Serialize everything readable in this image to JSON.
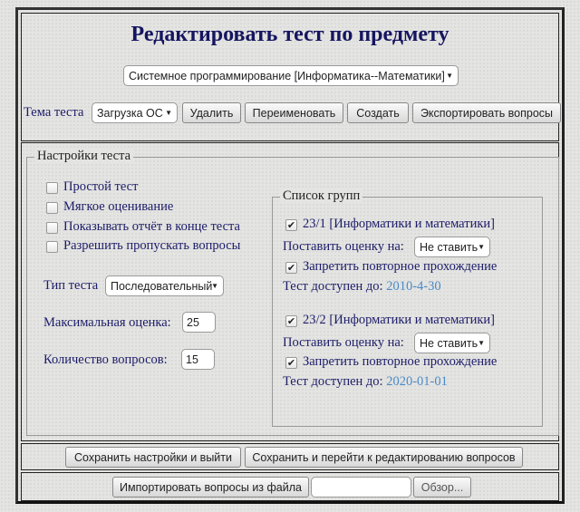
{
  "header": {
    "title": "Редактировать тест по предмету",
    "subject_select": "Системное программирование [Информатика--Математики]",
    "topic_label": "Тема теста",
    "topic_select": "Загрузка ОС",
    "delete": "Удалить",
    "rename": "Переименовать",
    "create": "Создать",
    "export": "Экспортировать вопросы"
  },
  "settings": {
    "legend": "Настройки теста",
    "options": [
      {
        "label": "Простой тест",
        "checked": false
      },
      {
        "label": "Мягкое оценивание",
        "checked": false
      },
      {
        "label": "Показывать отчёт в конце теста",
        "checked": false
      },
      {
        "label": "Разрешить пропускать вопросы",
        "checked": false
      }
    ],
    "type_label": "Тип теста",
    "type_value": "Последовательный",
    "max_label": "Максимальная оценка:",
    "max_value": "25",
    "count_label": "Количество вопросов:",
    "count_value": "15"
  },
  "groups": {
    "legend": "Список групп",
    "items": [
      {
        "name": "23/1 [Информатики и математики]",
        "checked": true,
        "grade_label": "Поставить оценку на:",
        "grade_value": "Не ставить",
        "forbid_label": "Запретить повторное прохождение",
        "forbid_checked": true,
        "until_label": "Тест доступен до:",
        "until_value": "2010-4-30"
      },
      {
        "name": "23/2 [Информатики и математики]",
        "checked": true,
        "grade_label": "Поставить оценку на:",
        "grade_value": "Не ставить",
        "forbid_label": "Запретить повторное прохождение",
        "forbid_checked": true,
        "until_label": "Тест доступен до:",
        "until_value": "2020-01-01"
      }
    ]
  },
  "footer": {
    "save_exit": "Сохранить настройки и выйти",
    "save_edit": "Сохранить и перейти к редактированию вопросов",
    "import": "Импортировать вопросы из файла",
    "file_value": "",
    "browse": "Обзор..."
  },
  "icons": {
    "check": "✔",
    "arrow": "▼"
  }
}
